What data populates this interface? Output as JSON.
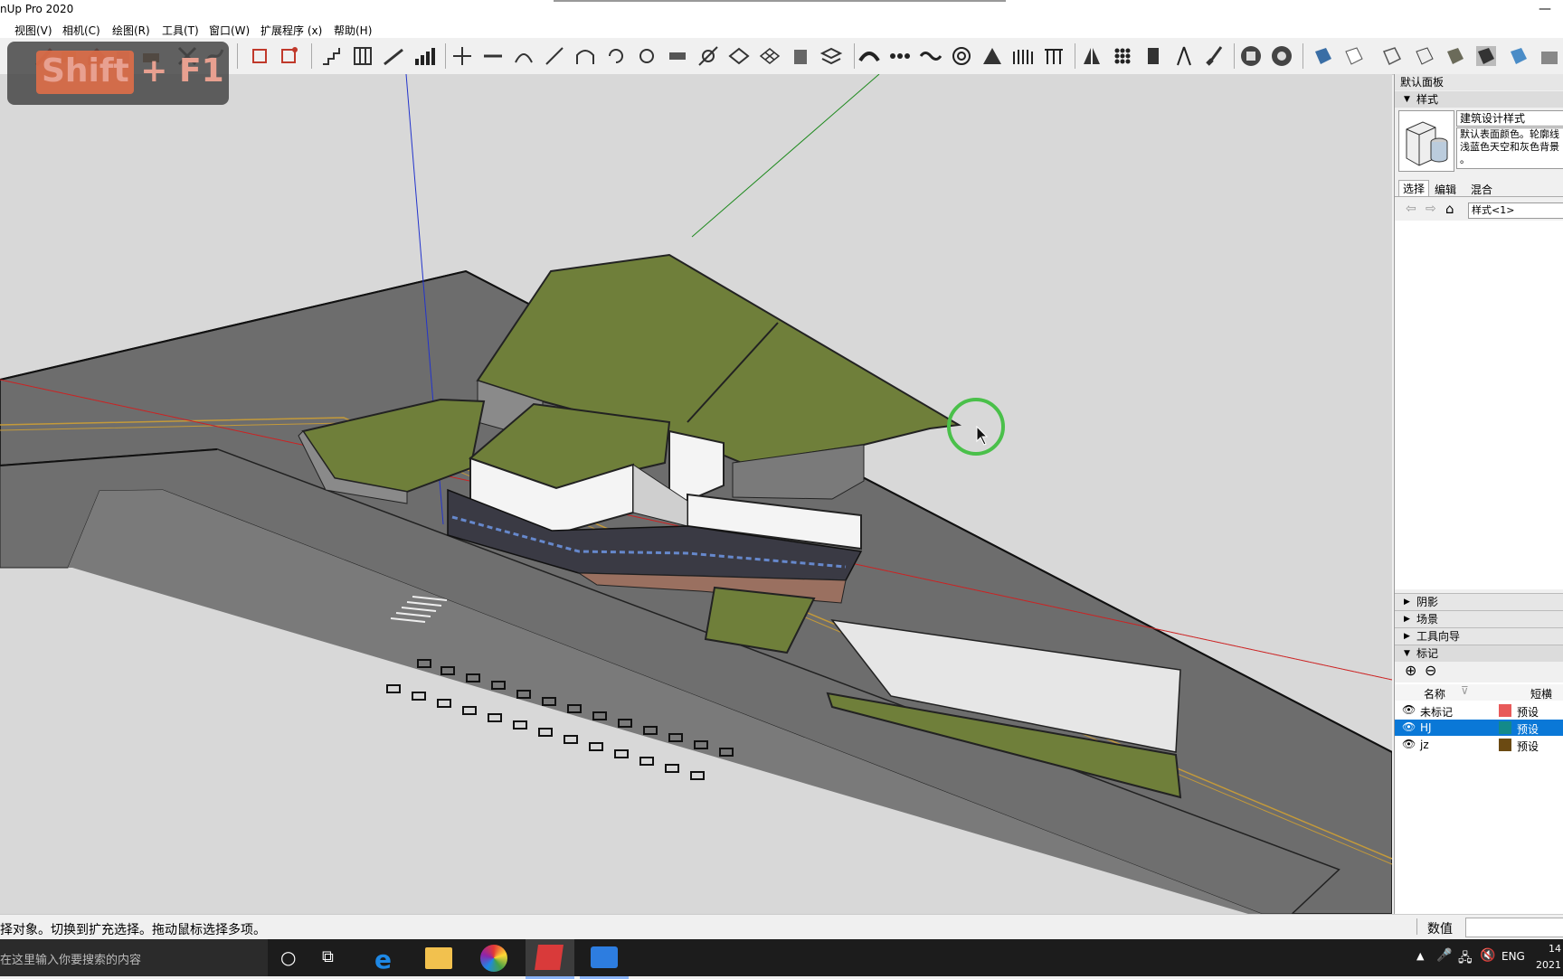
{
  "app": {
    "title": "nUp Pro 2020"
  },
  "menu": [
    "视图(V)",
    "相机(C)",
    "绘图(R)",
    "工具(T)",
    "窗口(W)",
    "扩展程序 (x)",
    "帮助(H)"
  ],
  "shortcut_overlay": "Shift + F1",
  "tray": {
    "title": "默认面板",
    "styles": {
      "header": "样式",
      "name": "建筑设计样式",
      "description": "默认表面颜色。轮廓线 浅蓝色天空和灰色背景 。",
      "tabs": [
        "选择",
        "编辑",
        "混合"
      ],
      "dropdown": "样式<1>"
    },
    "collapsed": [
      "阴影",
      "场景",
      "工具向导"
    ],
    "tags": {
      "header": "标记",
      "col_name": "名称",
      "col_dash": "短横",
      "rows": [
        {
          "name": "未标记",
          "color": "#e85a5a",
          "dash": "预设",
          "selected": false
        },
        {
          "name": "HJ",
          "color": "#138a8a",
          "dash": "预设",
          "selected": true
        },
        {
          "name": "jz",
          "color": "#6b4a12",
          "dash": "预设",
          "selected": false
        }
      ]
    }
  },
  "status": {
    "message": "择对象。切换到扩充选择。拖动鼠标选择多项。",
    "measure_label": "数值"
  },
  "taskbar": {
    "search_placeholder": "在这里输入你要搜索的内容",
    "lang": "ENG",
    "time": "14",
    "date": "2021"
  },
  "colors": {
    "grass": "#6f7f3a",
    "road": "#6e6e6e",
    "sky": "#d8d8d8",
    "selection": "#0a78d7"
  }
}
